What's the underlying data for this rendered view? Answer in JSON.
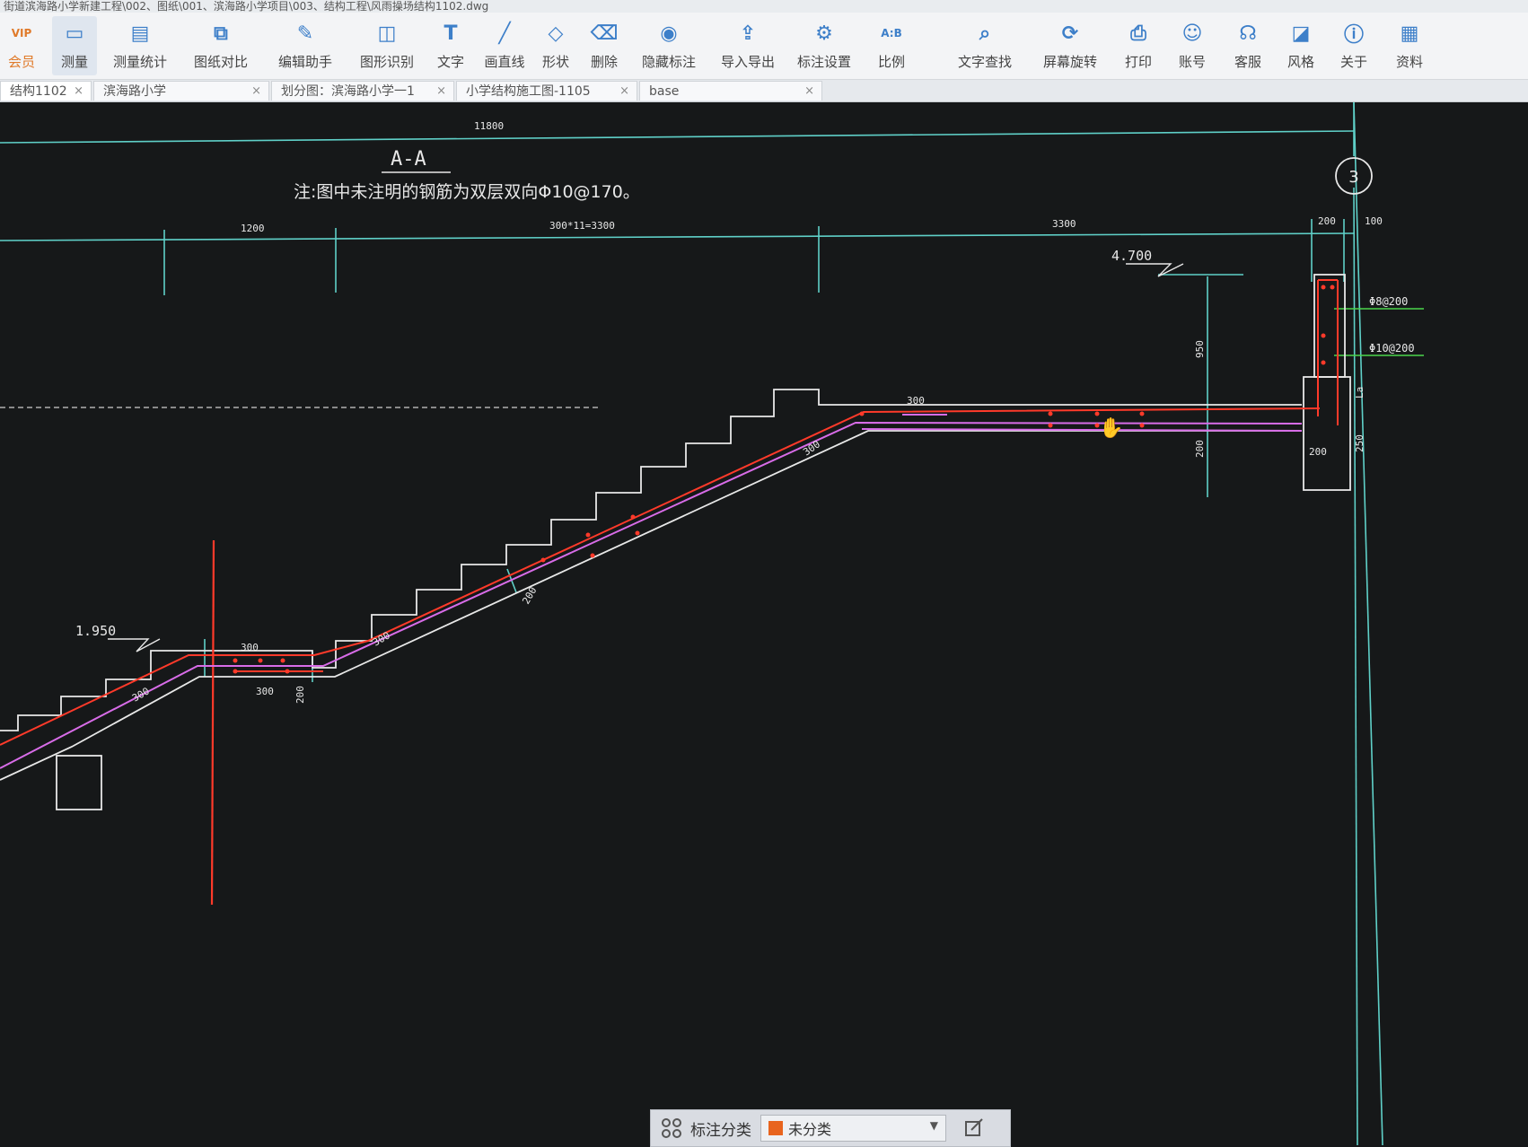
{
  "window": {
    "title": "街道滨海路小学新建工程\\002、图纸\\001、滨海路小学项目\\003、结构工程\\风雨操场结构1102.dwg"
  },
  "toolbar": {
    "items": [
      {
        "label": "会员",
        "icon": "vip-icon"
      },
      {
        "label": "测量",
        "icon": "measure-icon"
      },
      {
        "label": "测量统计",
        "icon": "measure-stats-icon"
      },
      {
        "label": "图纸对比",
        "icon": "compare-icon"
      },
      {
        "label": "编辑助手",
        "icon": "edit-assistant-icon"
      },
      {
        "label": "图形识别",
        "icon": "shape-recognition-icon"
      },
      {
        "label": "文字",
        "icon": "text-icon"
      },
      {
        "label": "画直线",
        "icon": "line-icon"
      },
      {
        "label": "形状",
        "icon": "shape-icon"
      },
      {
        "label": "删除",
        "icon": "eraser-icon"
      },
      {
        "label": "隐藏标注",
        "icon": "hide-icon"
      },
      {
        "label": "导入导出",
        "icon": "import-export-icon"
      },
      {
        "label": "标注设置",
        "icon": "annotation-settings-icon"
      },
      {
        "label": "比例",
        "icon": "scale-icon"
      },
      {
        "label": "文字查找",
        "icon": "text-search-icon"
      },
      {
        "label": "屏幕旋转",
        "icon": "rotate-icon"
      },
      {
        "label": "打印",
        "icon": "print-icon"
      },
      {
        "label": "账号",
        "icon": "account-icon"
      },
      {
        "label": "客服",
        "icon": "headset-icon"
      },
      {
        "label": "风格",
        "icon": "style-icon"
      },
      {
        "label": "关于",
        "icon": "info-icon"
      },
      {
        "label": "资料",
        "icon": "docs-icon"
      }
    ]
  },
  "tabs": [
    {
      "label": "结构1102",
      "close": "×"
    },
    {
      "label": "滨海路小学",
      "close": "×"
    },
    {
      "label": "划分图：滨海路小学一1",
      "close": "×"
    },
    {
      "label": "小学结构施工图-1105",
      "close": "×"
    },
    {
      "label": "base",
      "close": "×"
    }
  ],
  "drawing": {
    "section_title": "A-A",
    "note": "注:图中未注明的钢筋为双层双向Φ10@170。",
    "axis_label": "3",
    "dims": {
      "overall": "11800",
      "d1200": "1200",
      "d3300a": "300*11=3300",
      "d3300b": "3300",
      "d200": "200",
      "d100": "100",
      "d950": "950",
      "d300_landing": "300",
      "d200_slab": "200",
      "d200_beam": "200",
      "d250": "250",
      "d300_flight": "300",
      "d200_flight": "200",
      "d300_low": "300",
      "d300_lower_a": "300",
      "d300_lower_b": "300",
      "d300_flight2": "300",
      "d200_low": "200",
      "d300_bottom": "300",
      "d200_bottom": "200",
      "la": "La"
    },
    "levels": {
      "upper": "4.700",
      "lower": "1.950"
    },
    "rebar": {
      "stirrup": "Φ8@200",
      "long": "Φ10@200"
    }
  },
  "bottombar": {
    "label": "标注分类",
    "value": "未分类",
    "swatch": "#e8641e"
  },
  "colors": {
    "accent": "#2f7ed8",
    "cad_white": "#e8e8e8",
    "cad_cyan": "#5fd0c8",
    "cad_red": "#ff3a2a",
    "cad_magenta": "#d86ce8",
    "cad_green": "#4cd64c"
  }
}
